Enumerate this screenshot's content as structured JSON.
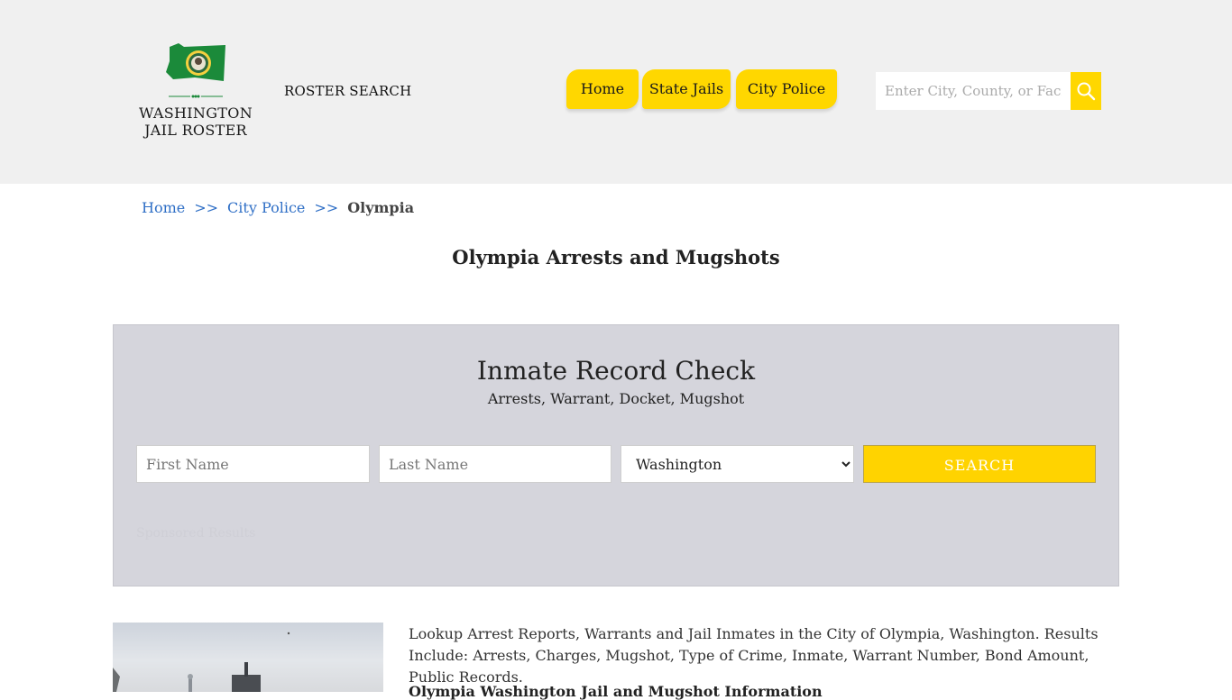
{
  "header": {
    "logo_line1": "WASHINGTON",
    "logo_line2": "JAIL ROSTER",
    "roster_search": "ROSTER SEARCH",
    "nav": [
      {
        "label": "Home"
      },
      {
        "label": "State Jails"
      },
      {
        "label": "City Police"
      }
    ],
    "search_placeholder": "Enter City, County, or Facility",
    "search_icon": "search-icon"
  },
  "breadcrumb": {
    "home": "Home",
    "sep1": ">>",
    "city_police": "City Police",
    "sep2": ">>",
    "current": "Olympia"
  },
  "page_title": "Olympia Arrests and Mugshots",
  "record_check": {
    "title": "Inmate Record Check",
    "subtitle": "Arrests, Warrant, Docket, Mugshot",
    "first_name_placeholder": "First Name",
    "last_name_placeholder": "Last Name",
    "state_selected": "Washington",
    "search_label": "SEARCH",
    "sponsored": "Sponsored Results"
  },
  "content": {
    "intro": "Lookup Arrest Reports, Warrants and Jail Inmates in the City of Olympia, Washington. Results Include: Arrests, Charges, Mugshot, Type of Crime, Inmate, Warrant Number, Bond Amount, Public Records.",
    "subhead": "Olympia Washington Jail and Mugshot Information"
  },
  "colors": {
    "accent": "#ffd700",
    "header_bg": "#f0f0f0",
    "link": "#2f6fc6",
    "panel_bg": "#d5d5dc"
  }
}
